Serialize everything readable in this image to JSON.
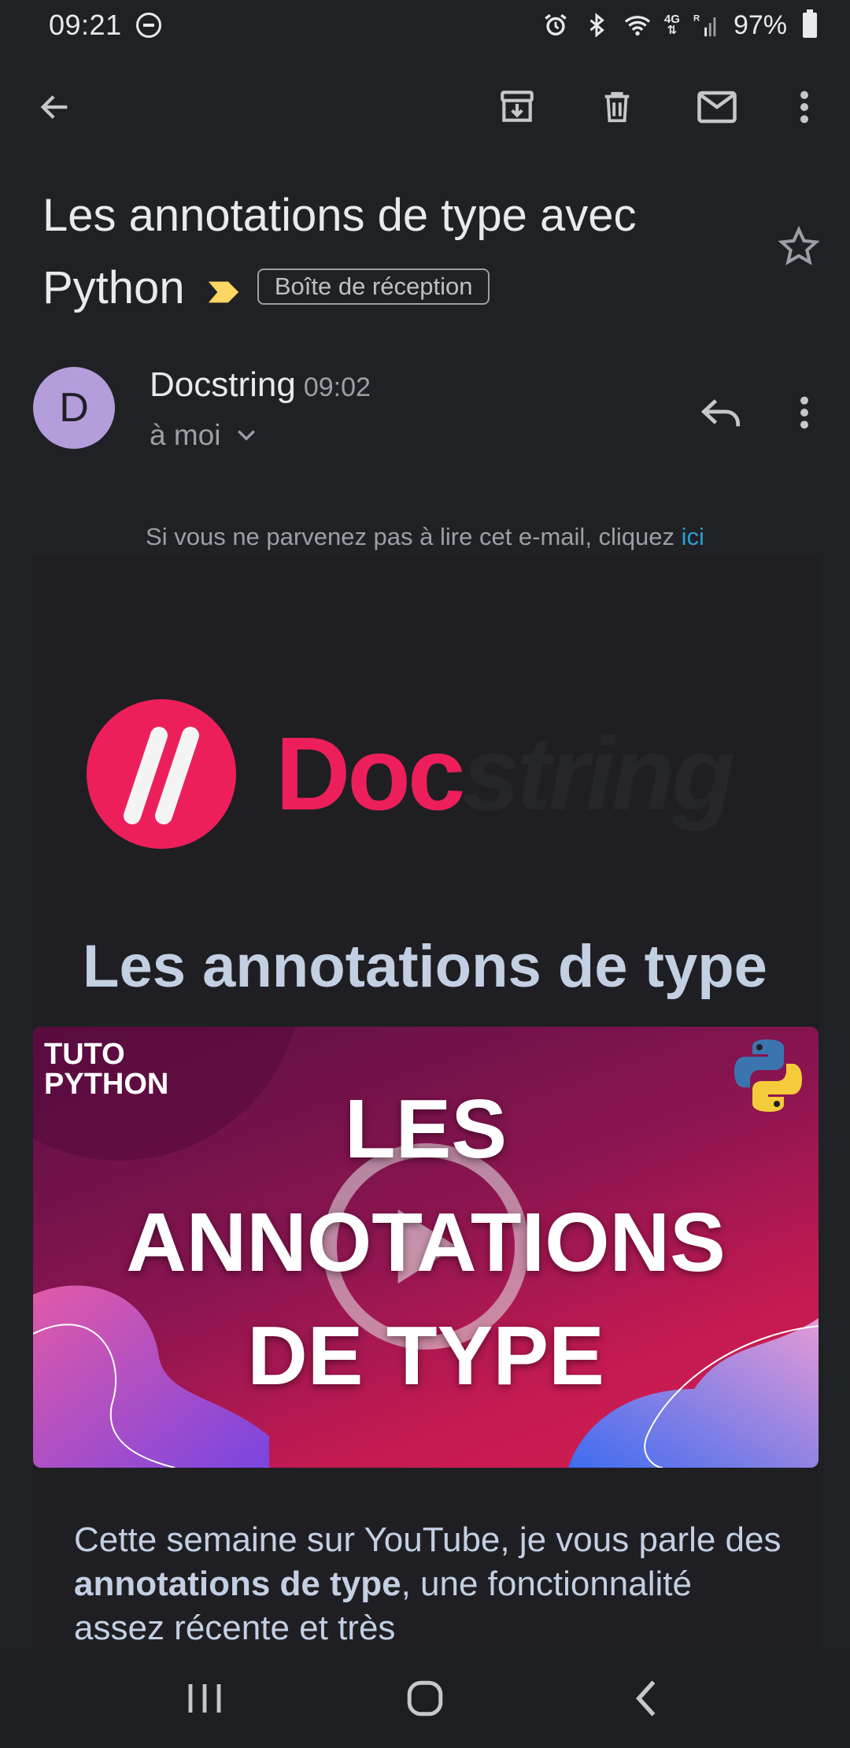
{
  "status_bar": {
    "time": "09:21",
    "net_type": "4G",
    "net_flag": "R",
    "battery": "97%"
  },
  "toolbar": {
    "back": "back-arrow-icon",
    "archive": "archive-icon",
    "delete": "delete-icon",
    "mark_unread": "mail-icon",
    "more": "more-vert-icon"
  },
  "email": {
    "subject": "Les annotations de type avec Python",
    "label": "Boîte de réception",
    "sender": {
      "initial": "D",
      "name": "Docstring",
      "time": "09:02",
      "recipient": "à moi",
      "avatar_color": "#b39ddb"
    }
  },
  "body": {
    "notice_text": "Si vous ne parvenez pas à lire cet e-mail, cliquez ",
    "notice_link": "ici",
    "logo_doc": "Doc",
    "logo_string": "string",
    "headline": "Les annotations de type",
    "video": {
      "tag_line1": "TUTO",
      "tag_line2": "PYTHON",
      "title_line1": "LES",
      "title_line2": "ANNOTATIONS",
      "title_line3": "DE TYPE"
    },
    "intro_part1": "Cette semaine sur YouTube, je vous parle des ",
    "intro_bold": "annotations de type",
    "intro_part2": ", une fonctionnalité assez récente et très"
  },
  "colors": {
    "brand": "#ed1f5a",
    "link": "#2a9fd6",
    "headline": "#c3cfe2",
    "importance": "#fdd663"
  }
}
